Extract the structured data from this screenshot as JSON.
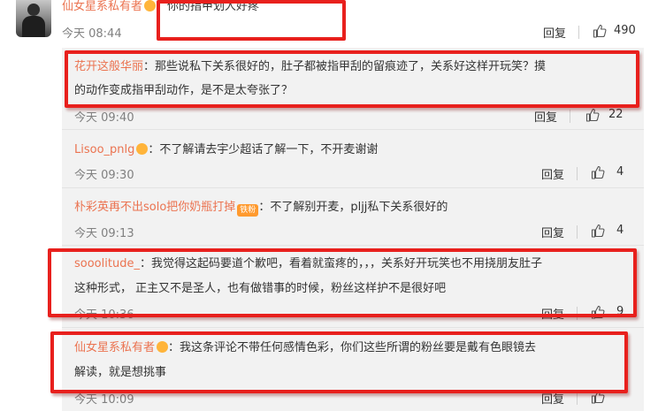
{
  "main_comment": {
    "username": "仙女星系私有者",
    "separator": "：",
    "text": "你的指甲划人好疼",
    "time": "今天 08:44",
    "reply_label": "回复",
    "likes": "490"
  },
  "replies": [
    {
      "username": "花开这般华丽",
      "separator": "：",
      "text_line1": "那些说私下关系很好的，肚子都被指甲刮的留痕迹了，关系好这样开玩笑？摸",
      "text_line2": "的动作变成指甲刮动作，是不是太夸张了？",
      "time": "今天 09:40",
      "reply_label": "回复",
      "likes": "22"
    },
    {
      "username": "Lisoo_pnlg",
      "separator": "：",
      "text_line1": "不了解请去宇少超话了解一下，不开麦谢谢",
      "time": "今天 09:30",
      "reply_label": "回复",
      "likes": "4"
    },
    {
      "username": "朴彩英再不出solo把你奶瓶打掉",
      "badge": "铁粉",
      "separator": "：",
      "text_line1": "不了解别开麦，pljj私下关系很好的",
      "time": "今天 09:13",
      "reply_label": "回复",
      "likes": "4"
    },
    {
      "username": "sooolitude_",
      "separator": "：",
      "text_line1": "我觉得这起码要道个歉吧，看着就蛮疼的，，，关系好开玩笑也不用挠朋友肚子",
      "text_line2": "这种形式， 正主又不是圣人，也有做错事的时候，粉丝这样护不是很好吧",
      "time": "今天 10:36",
      "reply_label": "回复",
      "likes": "9"
    },
    {
      "username": "仙女星系私有者",
      "separator": "：",
      "text_line1": "我这条评论不带任何感情色彩，你们这些所谓的粉丝要是戴有色眼镜去",
      "text_line2": "解读，就是想挑事",
      "time": "今天 10:09",
      "reply_label": "回复",
      "likes": ""
    }
  ],
  "colors": {
    "username": "#eb7350",
    "highlight_box": "#e8201d",
    "reply_background": "#f2f2f2"
  },
  "icons": [
    "thumb-up-icon",
    "fan-level-badge-icon",
    "avatar"
  ]
}
